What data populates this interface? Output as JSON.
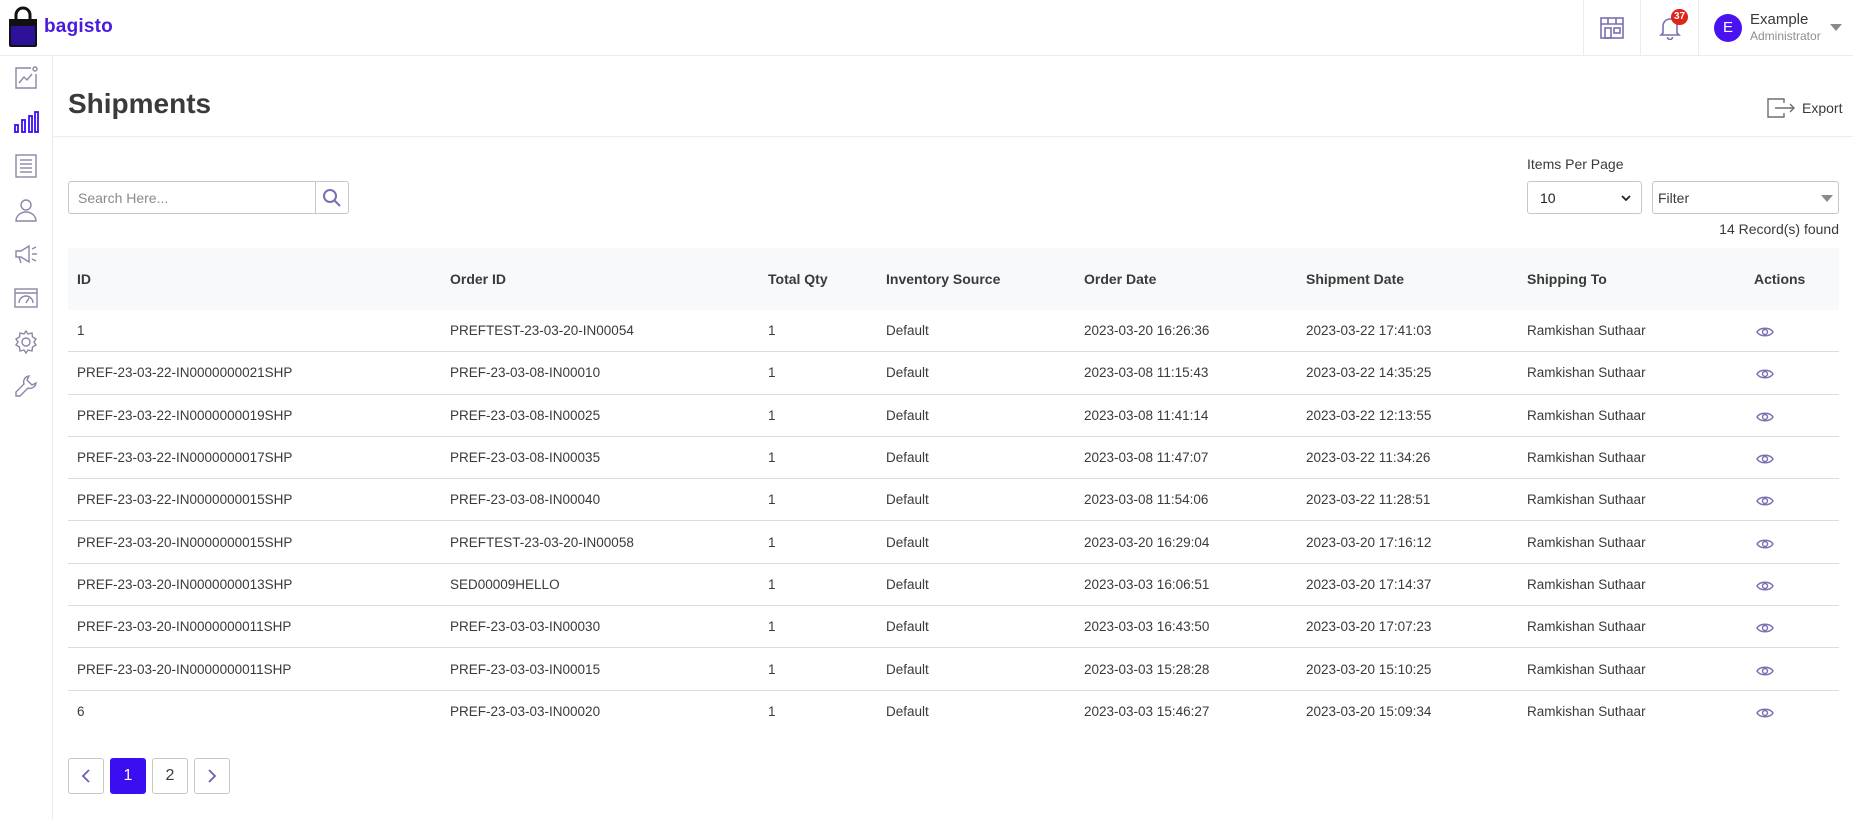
{
  "brand": {
    "name": "bagisto"
  },
  "header": {
    "notification_count": "37",
    "user_initial": "E",
    "user_name": "Example",
    "user_role": "Administrator"
  },
  "sidebar": {
    "items": [
      {
        "icon": "dashboard-icon"
      },
      {
        "icon": "sales-icon"
      },
      {
        "icon": "catalog-icon"
      },
      {
        "icon": "customers-icon"
      },
      {
        "icon": "marketing-icon"
      },
      {
        "icon": "cms-icon"
      },
      {
        "icon": "settings-icon"
      },
      {
        "icon": "configure-icon"
      }
    ]
  },
  "page": {
    "title": "Shipments",
    "export_label": "Export"
  },
  "controls": {
    "search_placeholder": "Search Here...",
    "items_per_page_label": "Items Per Page",
    "items_per_page_value": "10",
    "filter_label": "Filter",
    "records_found": "14 Record(s) found"
  },
  "table": {
    "headers": [
      "ID",
      "Order ID",
      "Total Qty",
      "Inventory Source",
      "Order Date",
      "Shipment Date",
      "Shipping To",
      "Actions"
    ],
    "rows": [
      [
        "1",
        "PREFTEST-23-03-20-IN00054",
        "1",
        "Default",
        "2023-03-20 16:26:36",
        "2023-03-22 17:41:03",
        "Ramkishan Suthaar"
      ],
      [
        "PREF-23-03-22-IN0000000021SHP",
        "PREF-23-03-08-IN00010",
        "1",
        "Default",
        "2023-03-08 11:15:43",
        "2023-03-22 14:35:25",
        "Ramkishan Suthaar"
      ],
      [
        "PREF-23-03-22-IN0000000019SHP",
        "PREF-23-03-08-IN00025",
        "1",
        "Default",
        "2023-03-08 11:41:14",
        "2023-03-22 12:13:55",
        "Ramkishan Suthaar"
      ],
      [
        "PREF-23-03-22-IN0000000017SHP",
        "PREF-23-03-08-IN00035",
        "1",
        "Default",
        "2023-03-08 11:47:07",
        "2023-03-22 11:34:26",
        "Ramkishan Suthaar"
      ],
      [
        "PREF-23-03-22-IN0000000015SHP",
        "PREF-23-03-08-IN00040",
        "1",
        "Default",
        "2023-03-08 11:54:06",
        "2023-03-22 11:28:51",
        "Ramkishan Suthaar"
      ],
      [
        "PREF-23-03-20-IN0000000015SHP",
        "PREFTEST-23-03-20-IN00058",
        "1",
        "Default",
        "2023-03-20 16:29:04",
        "2023-03-20 17:16:12",
        "Ramkishan Suthaar"
      ],
      [
        "PREF-23-03-20-IN0000000013SHP",
        "SED00009HELLO",
        "1",
        "Default",
        "2023-03-03 16:06:51",
        "2023-03-20 17:14:37",
        "Ramkishan Suthaar"
      ],
      [
        "PREF-23-03-20-IN0000000011SHP",
        "PREF-23-03-03-IN00030",
        "1",
        "Default",
        "2023-03-03 16:43:50",
        "2023-03-20 17:07:23",
        "Ramkishan Suthaar"
      ],
      [
        "PREF-23-03-20-IN0000000011SHP",
        "PREF-23-03-03-IN00015",
        "1",
        "Default",
        "2023-03-03 15:28:28",
        "2023-03-20 15:10:25",
        "Ramkishan Suthaar"
      ],
      [
        "6",
        "PREF-23-03-03-IN00020",
        "1",
        "Default",
        "2023-03-03 15:46:27",
        "2023-03-20 15:09:34",
        "Ramkishan Suthaar"
      ]
    ]
  },
  "pagination": {
    "pages": [
      "1",
      "2"
    ],
    "current": "1"
  },
  "colors": {
    "brand": "#4a1bdd",
    "accent": "#3b0ef2",
    "badge": "#e0241a"
  }
}
